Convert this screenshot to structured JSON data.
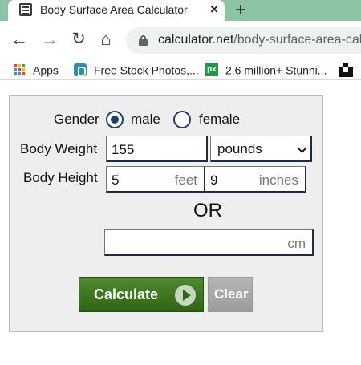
{
  "browser": {
    "tab_title": "Body Surface Area Calculator",
    "tab_close": "×",
    "new_tab": "+",
    "url_domain": "calculator.net",
    "url_path": "/body-surface-area-calc",
    "nav": {
      "back": "←",
      "forward": "→",
      "reload": "↻",
      "home": "⌂"
    },
    "bookmarks": [
      {
        "label": "Apps",
        "icon": "apps-grid-icon"
      },
      {
        "label": "Free Stock Photos,...",
        "icon": "free-stock-photos-icon"
      },
      {
        "label": "2.6 million+ Stunni...",
        "icon": "pixabay-icon",
        "icon_text": "px"
      },
      {
        "label": "",
        "icon": "extension-icon"
      }
    ]
  },
  "calculator": {
    "gender_label": "Gender",
    "gender_options": [
      {
        "label": "male",
        "selected": true
      },
      {
        "label": "female",
        "selected": false
      }
    ],
    "weight_label": "Body Weight",
    "weight_value": "155",
    "weight_unit_selected": "pounds",
    "height_label": "Body Height",
    "height_feet_value": "5",
    "height_feet_unit": "feet",
    "height_inches_value": "9",
    "height_inches_unit": "inches",
    "or_text": "OR",
    "height_cm_value": "",
    "height_cm_unit": "cm",
    "calculate_label": "Calculate",
    "clear_label": "Clear"
  },
  "colors": {
    "tabbar": "#8bc5a4",
    "radio_accent": "#1f3e68",
    "calculate_button": "#3d7622",
    "clear_button": "#a8a8a8"
  }
}
